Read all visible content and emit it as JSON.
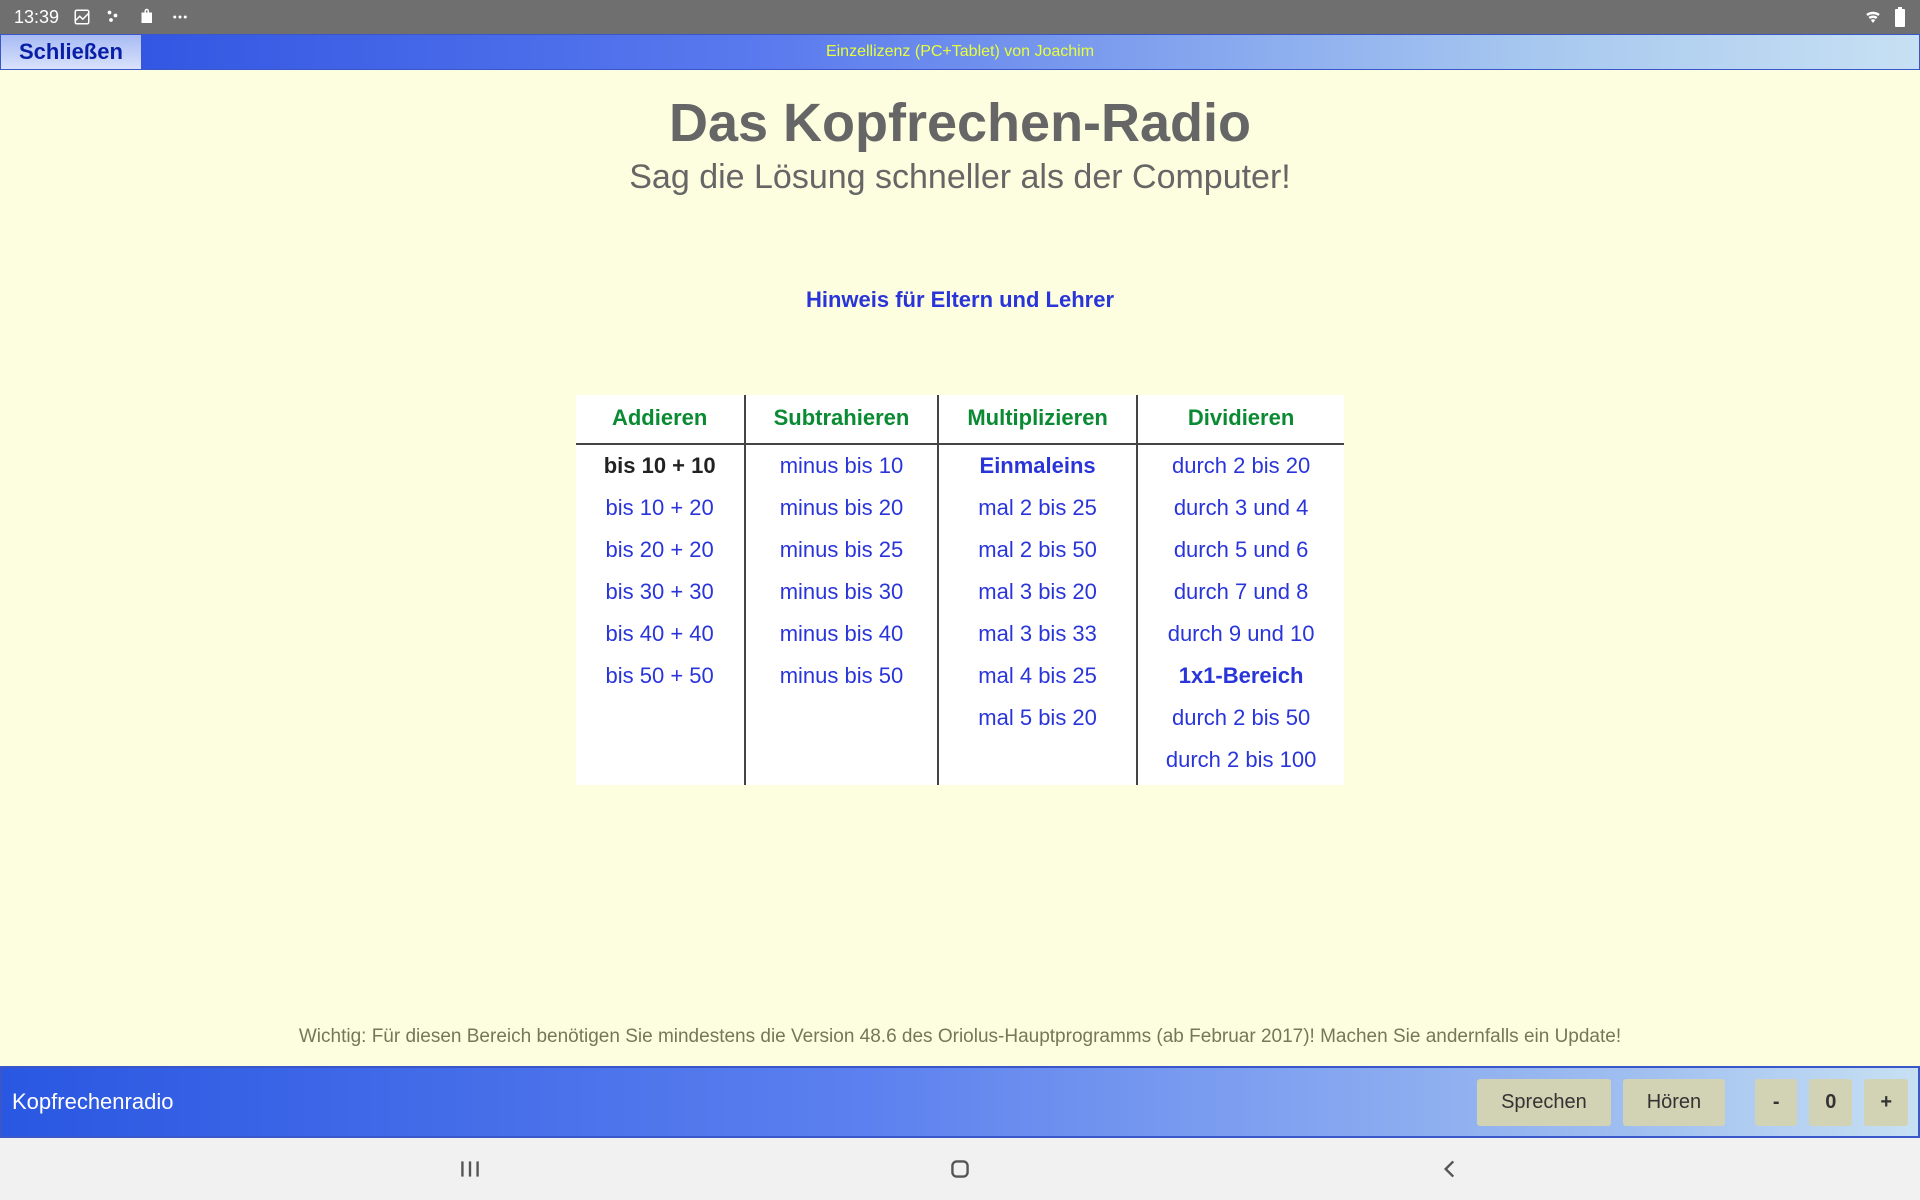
{
  "statusbar": {
    "time": "13:39"
  },
  "topbar": {
    "close": "Schließen",
    "license": "Einzellizenz (PC+Tablet) von Joachim"
  },
  "page": {
    "title": "Das Kopfrechen-Radio",
    "subtitle": "Sag die Lösung schneller als der Computer!",
    "hint": "Hinweis für Eltern und Lehrer",
    "notice": "Wichtig: Für diesen Bereich benötigen Sie mindestens die Version 48.6 des Oriolus-Hauptprogramms (ab Februar 2017)! Machen Sie andernfalls ein Update!"
  },
  "table": {
    "headers": [
      "Addieren",
      "Subtrahieren",
      "Multiplizieren",
      "Dividieren"
    ],
    "rows": [
      [
        {
          "t": "bis 10 + 10",
          "dark": true
        },
        {
          "t": "minus bis 10"
        },
        {
          "t": "Einmaleins",
          "bold": true
        },
        {
          "t": "durch 2 bis 20"
        }
      ],
      [
        {
          "t": "bis 10 + 20"
        },
        {
          "t": "minus bis 20"
        },
        {
          "t": "mal 2 bis 25"
        },
        {
          "t": "durch 3 und 4"
        }
      ],
      [
        {
          "t": "bis 20 + 20"
        },
        {
          "t": "minus bis 25"
        },
        {
          "t": "mal 2 bis 50"
        },
        {
          "t": "durch 5 und 6"
        }
      ],
      [
        {
          "t": "bis 30 + 30"
        },
        {
          "t": "minus bis 30"
        },
        {
          "t": "mal 3 bis 20"
        },
        {
          "t": "durch 7 und 8"
        }
      ],
      [
        {
          "t": "bis 40 + 40"
        },
        {
          "t": "minus bis 40"
        },
        {
          "t": "mal 3 bis 33"
        },
        {
          "t": "durch 9 und 10"
        }
      ],
      [
        {
          "t": "bis 50 + 50"
        },
        {
          "t": "minus bis 50"
        },
        {
          "t": "mal 4 bis 25"
        },
        {
          "t": "1x1-Bereich",
          "bold": true
        }
      ],
      [
        {
          "t": ""
        },
        {
          "t": ""
        },
        {
          "t": "mal 5 bis 20"
        },
        {
          "t": "durch 2 bis 50"
        }
      ],
      [
        {
          "t": ""
        },
        {
          "t": ""
        },
        {
          "t": ""
        },
        {
          "t": "durch 2 bis 100"
        }
      ]
    ]
  },
  "bottombar": {
    "appname": "Kopfrechenradio",
    "speak": "Sprechen",
    "listen": "Hören",
    "minus": "-",
    "value": "0",
    "plus": "+"
  }
}
